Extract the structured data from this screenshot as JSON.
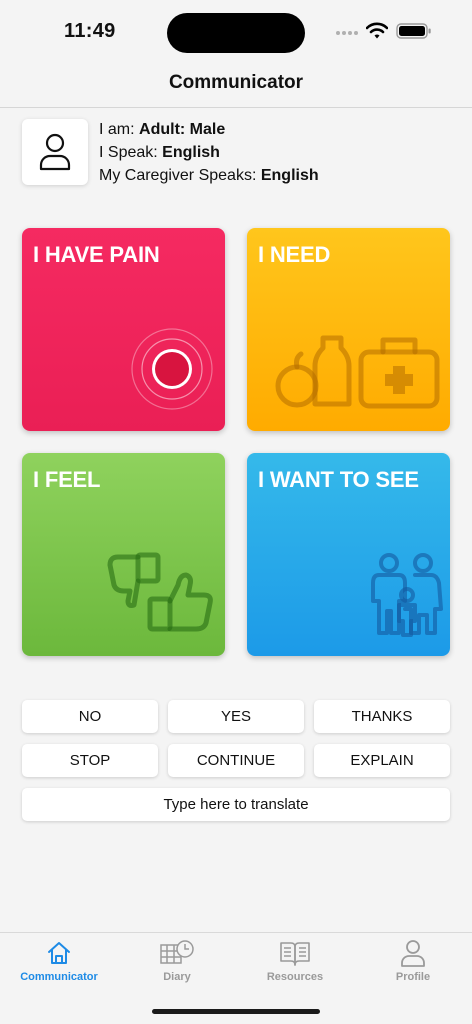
{
  "status": {
    "time": "11:49"
  },
  "nav": {
    "title": "Communicator"
  },
  "profile": {
    "icon": "person-icon",
    "i_am_label": "I am:",
    "i_am_value": "Adult: Male",
    "speak_label": "I Speak:",
    "speak_value": "English",
    "caregiver_label": "My Caregiver Speaks:",
    "caregiver_value": "English"
  },
  "tiles": [
    {
      "label": "I HAVE PAIN",
      "color": "#F0255C",
      "icon": "pain-target-icon"
    },
    {
      "label": "I NEED",
      "color": "#FFB90D",
      "icon": "food-medkit-icon"
    },
    {
      "label": "I FEEL",
      "color": "#7EC54C",
      "icon": "thumbs-icon"
    },
    {
      "label": "I WANT TO SEE",
      "color": "#29AAE9",
      "icon": "family-icon"
    }
  ],
  "quick_buttons": [
    "NO",
    "YES",
    "THANKS",
    "STOP",
    "CONTINUE",
    "EXPLAIN"
  ],
  "translate": {
    "placeholder": "Type here to translate"
  },
  "tabbar": {
    "items": [
      {
        "label": "Communicator",
        "icon": "home-icon",
        "active": true
      },
      {
        "label": "Diary",
        "icon": "calendar-clock-icon",
        "active": false
      },
      {
        "label": "Resources",
        "icon": "book-icon",
        "active": false
      },
      {
        "label": "Profile",
        "icon": "person-icon",
        "active": false
      }
    ]
  },
  "colors": {
    "accent": "#1E8BE6",
    "inactive": "#9A9A9A"
  }
}
